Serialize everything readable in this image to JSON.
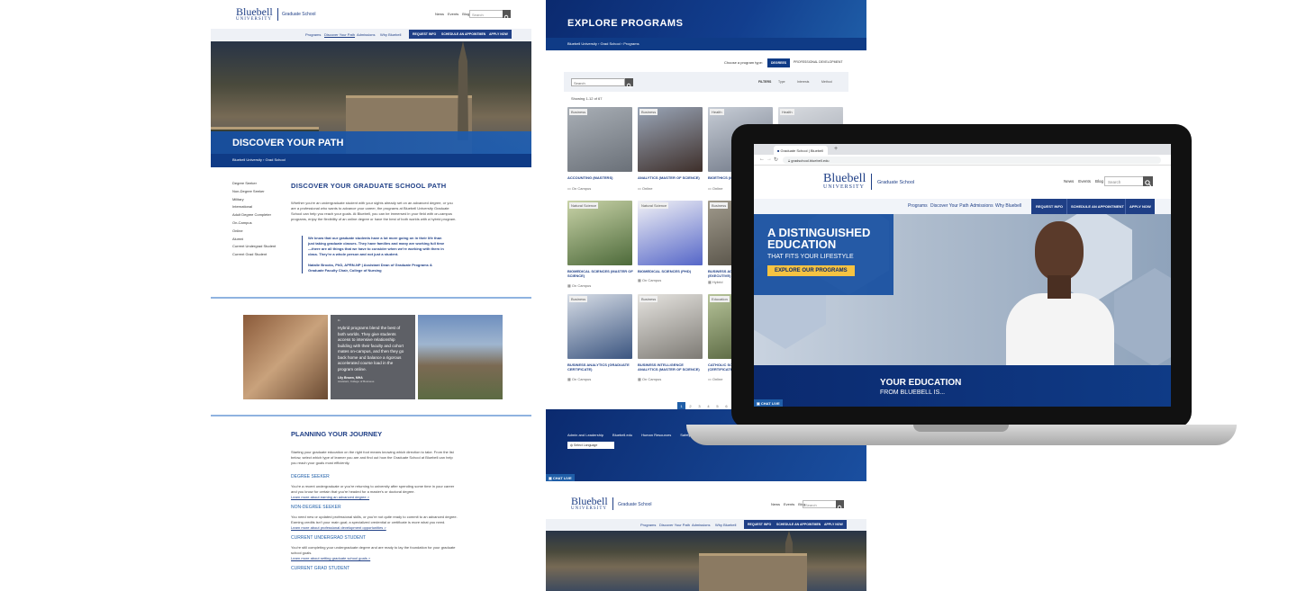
{
  "brand": {
    "name": "Bluebell",
    "sub": "UNIVERSITY",
    "school": "Graduate School"
  },
  "topnav": {
    "news": "News",
    "events": "Events",
    "blog": "Blog",
    "search_ph": "Search"
  },
  "mainnav": {
    "programs": "Programs",
    "discover": "Discover Your Path",
    "admissions": "Admissions",
    "why": "Why Bluebell",
    "request": "REQUEST INFO",
    "schedule": "SCHEDULE AN APPOINTMENT",
    "apply": "APPLY NOW"
  },
  "left": {
    "hero_title": "DISCOVER YOUR PATH",
    "crumb": "Bluebell University  ›  Grad School",
    "sidebar": [
      "Degree Seeker",
      "Non-Degree Seeker",
      "Military",
      "International",
      "Adult Degree Completer",
      "On-Campus",
      "Online",
      "Alumni",
      "Current Undergrad Student",
      "Current Grad Student"
    ],
    "section_title": "DISCOVER YOUR GRADUATE SCHOOL PATH",
    "intro": "Whether you're an undergraduate student with your sights already set on an advanced degree, or you are a professional who wants to advance your career, the programs at Bluebell University Graduate School can help you reach your goals. At Bluebell, you can be immersed in your field with on-campus programs, enjoy the flexibility of an online degree or have the best of both worlds with a hybrid program.",
    "quote": "We know that our graduate students have a lot more going on in their life than just taking graduate classes. They have families and many are working full time—there are all things that we have to consider when we're working with them in class. They're a whole person and not just a student.",
    "quote_by": "Natalie Brooks, PhD, APRN-NP | Assistant Dean of Graduate Programs & Graduate Faculty Chair, College of Nursing",
    "testimonial": "Hybrid programs blend the best of both worlds. They give students access to intensive relationship building with their faculty and cohort mates on-campus, and then they go back home and balance a rigorous accelerated course load in the program online.",
    "testimonial_by": "Lily Brown, MHA",
    "testimonial_role": "Assistant, College of Business",
    "planning_title": "PLANNING YOUR JOURNEY",
    "planning_intro": "Starting your graduate education on the right foot means knowing which direction to take. From the list below, select which type of learner you are and find out how the Graduate School at Bluebell can help you reach your goals most efficiently.",
    "items": [
      {
        "h": "DEGREE SEEKER",
        "p": "You're a recent undergraduate or you're returning to university after spending some time in your career and you know for certain that you're headed for a master's or doctoral degree.",
        "link": "Learn more about earning an advanced degree >"
      },
      {
        "h": "NON-DEGREE SEEKER",
        "p": "You need new or updated professional skills, or you're not quite ready to commit to an advanced degree. Earning credits isn't your main goal; a specialized credential or certificate is more what you need.",
        "link": "Learn more about professional development opportunities >"
      },
      {
        "h": "CURRENT UNDERGRAD STUDENT",
        "p": "You're still completing your undergraduate degree and are ready to lay the foundation for your graduate school goals.",
        "link": "Learn more about setting graduate school goals >"
      },
      {
        "h": "CURRENT GRAD STUDENT",
        "p": "",
        "link": ""
      }
    ]
  },
  "middle": {
    "hero_title": "EXPLORE PROGRAMS",
    "crumb": "Bluebell University  ›  Grad School  ›  Programs",
    "choose": "Choose a program type:",
    "type_degrees": "DEGREES",
    "type_pd": "PROFESSIONAL DEVELOPMENT",
    "search_ph": "Search",
    "filters": "FILTERS",
    "f_type": "Type",
    "f_interests": "Interests",
    "f_method": "Method",
    "showing": "Showing 1-12 of 67",
    "cards": [
      {
        "tag": "Business",
        "title": "ACCOUNTING (MASTERS)",
        "meta": "On Campus",
        "color": "#7a7f86"
      },
      {
        "tag": "Business",
        "title": "ANALYTICS (MASTER OF SCIENCE)",
        "meta": "Online",
        "color": "#5c4b44"
      },
      {
        "tag": "Health",
        "title": "BIOETHICS (MASTER OF)",
        "meta": "Online",
        "color": "#8c94a3"
      },
      {
        "tag": "Health",
        "title": "",
        "meta": "",
        "color": "#b8bcc4"
      },
      {
        "tag": "Natural Science",
        "title": "BIOMEDICAL SCIENCES (MASTER OF SCIENCE)",
        "meta": "On Campus",
        "color": "#7d8a5b"
      },
      {
        "tag": "Natural Science",
        "title": "BIOMEDICAL SCIENCES (PHD)",
        "meta": "On Campus",
        "color": "#c4c8d6"
      },
      {
        "tag": "Business",
        "title": "BUSINESS ADMINISTRATION (EXECUTIVE)",
        "meta": "Hybrid",
        "color": "#6f6a60"
      },
      {
        "tag": "",
        "title": "",
        "meta": "",
        "color": "#9aa0a6"
      },
      {
        "tag": "Business",
        "title": "BUSINESS ANALYTICS (GRADUATE CERTIFICATE)",
        "meta": "On Campus",
        "color": "#546a8a"
      },
      {
        "tag": "Business",
        "title": "BUSINESS INTELLIGENCE ANALYTICS (MASTER OF SCIENCE)",
        "meta": "On Campus",
        "color": "#8d8a86"
      },
      {
        "tag": "Education",
        "title": "CATHOLIC SCHOOL LEADERSHIP (CERTIFICATE)",
        "meta": "Online",
        "color": "#6b7a55"
      },
      {
        "tag": "",
        "title": "",
        "meta": "",
        "color": "#a9a9a9"
      }
    ],
    "pages": [
      "1",
      "2",
      "3",
      "4",
      "5",
      "6"
    ],
    "footer_links": [
      "Admin and Leadership",
      "Bluebell.edu",
      "Human Resources",
      "Safety"
    ],
    "select_language": "Select Language",
    "chat": "CHAT LIVE"
  },
  "laptop": {
    "tab_title": "Graduate School | Bluebell",
    "url": "gradschool.bluebell.edu",
    "hero_line1": "A DISTINGUISHED",
    "hero_line2": "EDUCATION",
    "hero_sub": "THAT FITS YOUR LIFESTYLE",
    "hero_btn": "EXPLORE OUR PROGRAMS",
    "band_line1": "YOUR EDUCATION",
    "band_line2": "FROM BLUEBELL IS...",
    "chat": "CHAT LIVE"
  },
  "colors": {
    "navy": "#0b2a6f",
    "blue": "#1f5ea8",
    "gold": "#f5c342"
  }
}
